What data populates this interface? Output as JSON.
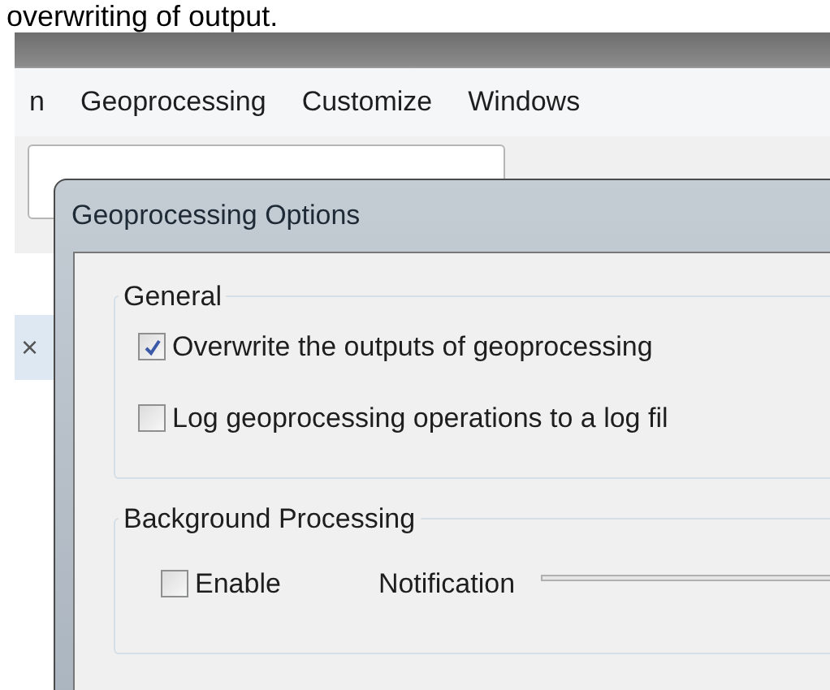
{
  "caption": "overwriting of output.",
  "menu": [
    "n",
    "Geoprocessing",
    "Customize",
    "Windows"
  ],
  "side_panel": {
    "close": "×"
  },
  "dialog": {
    "title": "Geoprocessing Options",
    "groups": [
      {
        "title": "General",
        "items": [
          {
            "kind": "checkbox",
            "label": "Overwrite the outputs of geoprocessing",
            "checked": true
          },
          {
            "kind": "checkbox",
            "label": "Log geoprocessing operations to a log fil",
            "checked": false
          }
        ]
      },
      {
        "title": "Background Processing",
        "items": [
          {
            "kind": "checkbox",
            "label": "Enable",
            "checked": false
          },
          {
            "kind": "slider",
            "label": "Notification"
          }
        ]
      }
    ]
  }
}
